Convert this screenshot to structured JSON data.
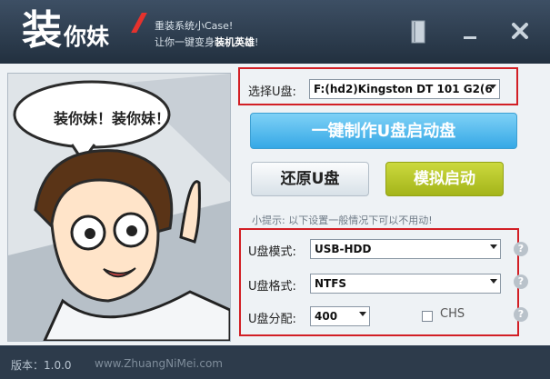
{
  "header": {
    "logo_big": "装",
    "logo_small": "你妹",
    "slogan_line1": "重装系统小Case!",
    "slogan_line2_prefix": "让你一键变身",
    "slogan_line2_bold": "装机英雄",
    "slogan_line2_suffix": "!"
  },
  "illustration": {
    "speech": "装你妹！装你妹！"
  },
  "usb_select": {
    "label": "选择U盘:",
    "value": "F:(hd2)Kingston DT 101 G2(6"
  },
  "buttons": {
    "make_boot": "一键制作U盘启动盘",
    "restore": "还原U盘",
    "simulate": "模拟启动"
  },
  "tip": "小提示: 以下设置一般情况下可以不用动!",
  "settings": {
    "mode_label": "U盘模式:",
    "mode_value": "USB-HDD",
    "format_label": "U盘格式:",
    "format_value": "NTFS",
    "partition_label": "U盘分配:",
    "partition_value": "400",
    "chs_label": "CHS"
  },
  "footer": {
    "version": "版本：1.0.0",
    "url": "www.ZhuangNiMei.com"
  },
  "colors": {
    "accent_red": "#d21f25",
    "primary_blue": "#35a8e6",
    "simulate_green": "#a4b51a"
  }
}
